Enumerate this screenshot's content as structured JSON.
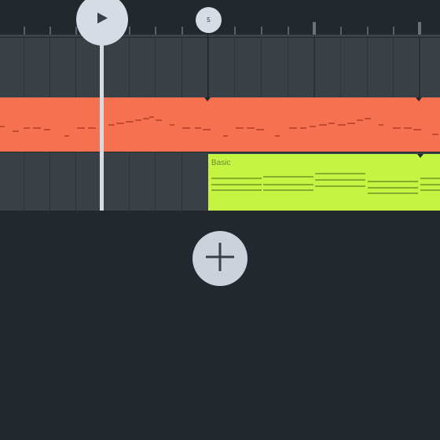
{
  "transport": {
    "play_icon": "play-icon"
  },
  "timeline": {
    "bar_badge": "5"
  },
  "tracks": [
    {
      "name": "",
      "color": "#3a4146"
    },
    {
      "name": "",
      "color": "#f5714f"
    },
    {
      "name": "",
      "color": "#3a4146"
    }
  ],
  "clips": [
    {
      "label": "Basic",
      "color": "#c5f542"
    }
  ],
  "actions": {
    "add_icon": "plus-icon"
  }
}
